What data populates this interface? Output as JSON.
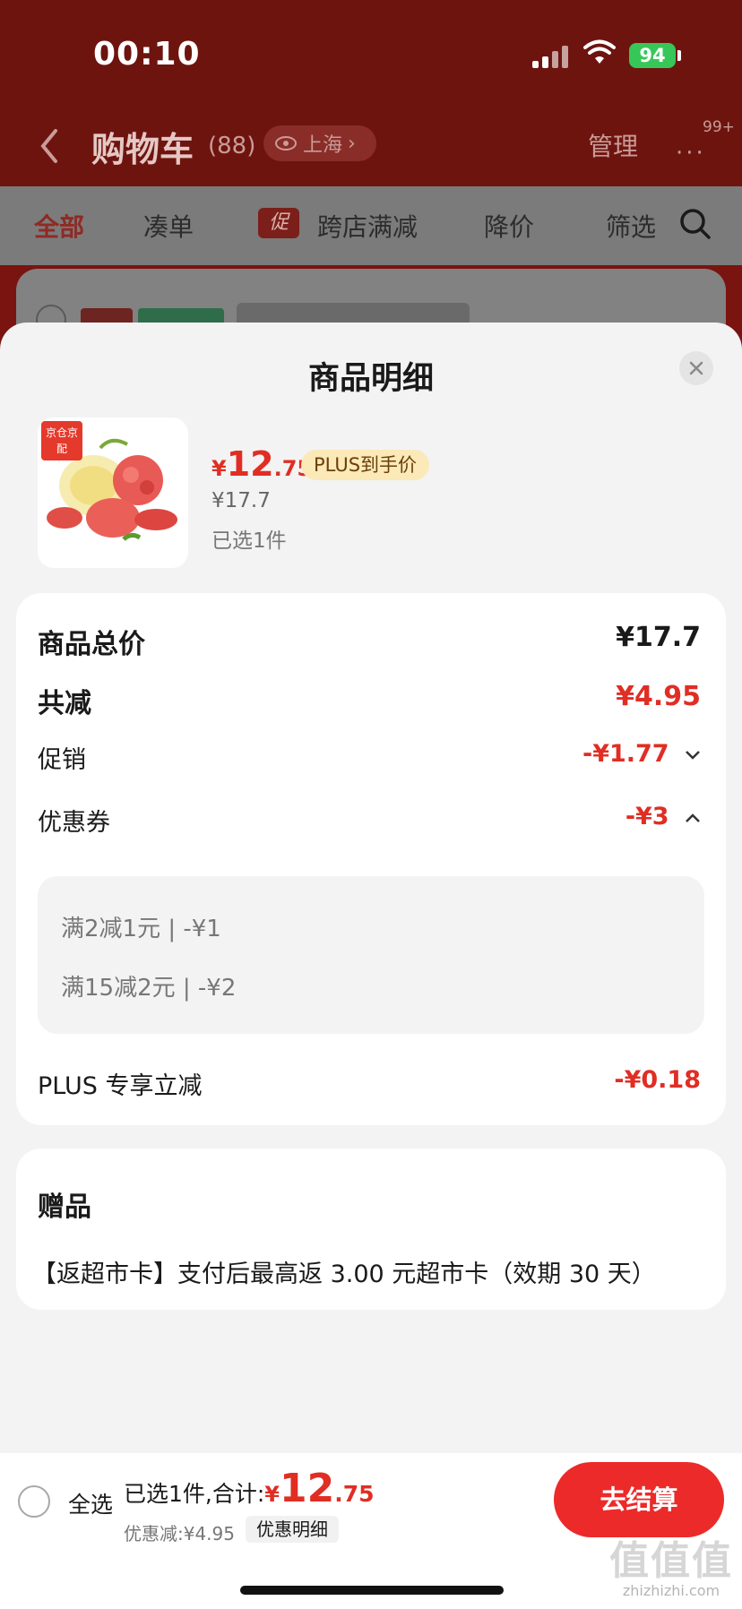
{
  "status_bar": {
    "time": "00:10",
    "battery": "94"
  },
  "cart_header": {
    "title": "购物车",
    "count": "(88)",
    "location": "上海",
    "manage": "管理",
    "message_badge": "99+"
  },
  "tabs": [
    {
      "label": "全部"
    },
    {
      "label": "凑单"
    },
    {
      "label": "跨店满减",
      "promo_mark": "促"
    },
    {
      "label": "降价"
    },
    {
      "label": "筛选"
    }
  ],
  "sheet": {
    "title": "商品明细",
    "product": {
      "brand_mark": "京仓京配",
      "price_currency": "¥",
      "price_integer": "12",
      "price_decimal": ".75",
      "plus_badge": "PLUS到手价",
      "original_price": "¥17.7",
      "selected": "已选1件"
    },
    "rows": {
      "total_label": "商品总价",
      "total_value": "¥17.7",
      "reduce_label": "共减",
      "reduce_value": "¥4.95",
      "promo_label": "促销",
      "promo_value": "-¥1.77",
      "coupon_label": "优惠券",
      "coupon_value": "-¥3",
      "coupons": [
        "满2减1元 | -¥1",
        "满15减2元 | -¥2"
      ],
      "plus_label": "PLUS 专享立减",
      "plus_value": "-¥0.18"
    },
    "gift": {
      "title": "赠品",
      "text": "【返超市卡】支付后最高返 3.00 元超市卡（效期 30 天）"
    }
  },
  "bottom_bar": {
    "select_all": "全选",
    "summary_prefix": "已选1件,合计:",
    "total_currency": "¥",
    "total_integer": "12",
    "total_decimal": ".75",
    "discount": "优惠减:¥4.95",
    "detail": "优惠明细",
    "checkout": "去结算"
  },
  "watermark": {
    "logo": "值值值",
    "url": "zhizhizhi.com"
  },
  "colors": {
    "accent_red": "#e02e24",
    "checkout_red": "#ec2a2a",
    "plus_gold": "#fbe9b8"
  }
}
